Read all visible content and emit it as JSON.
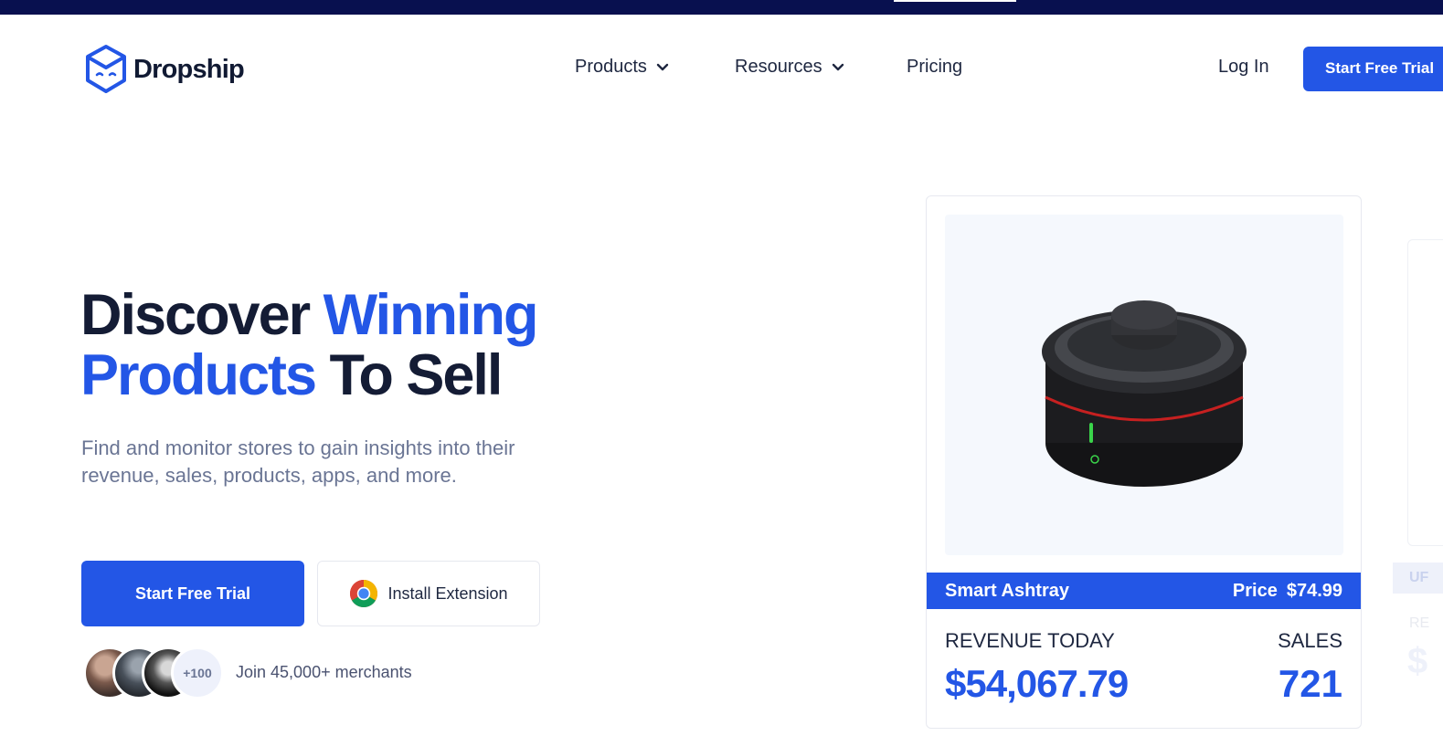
{
  "brand": {
    "name": "Dropship",
    "accent": "#2356e6",
    "top_bar": "#08104f"
  },
  "nav": {
    "items": [
      {
        "label": "Products",
        "icon": "chevron-down-icon"
      },
      {
        "label": "Resources",
        "icon": "chevron-down-icon"
      },
      {
        "label": "Pricing"
      }
    ],
    "login": "Log In",
    "cta": "Start Free Trial"
  },
  "hero": {
    "title_1": "Discover ",
    "title_accent_1": "Winning",
    "title_accent_2": "Products",
    "title_2": " To Sell",
    "subtitle": "Find and monitor stores to gain insights into their revenue, sales, products, apps, and more.",
    "primary_cta": "Start Free Trial",
    "secondary_cta": "Install Extension",
    "secondary_icon": "chrome-icon",
    "avatar_more": "+100",
    "merchants": "Join 45,000+ merchants"
  },
  "product_card": {
    "name": "Smart Ashtray",
    "price_label": "Price",
    "price": "$74.99",
    "revenue_label": "REVENUE TODAY",
    "revenue": "$54,067.79",
    "sales_label": "SALES",
    "sales": "721"
  },
  "ghost_card": {
    "bar_text": "UF",
    "label": "RE",
    "value": "$"
  }
}
